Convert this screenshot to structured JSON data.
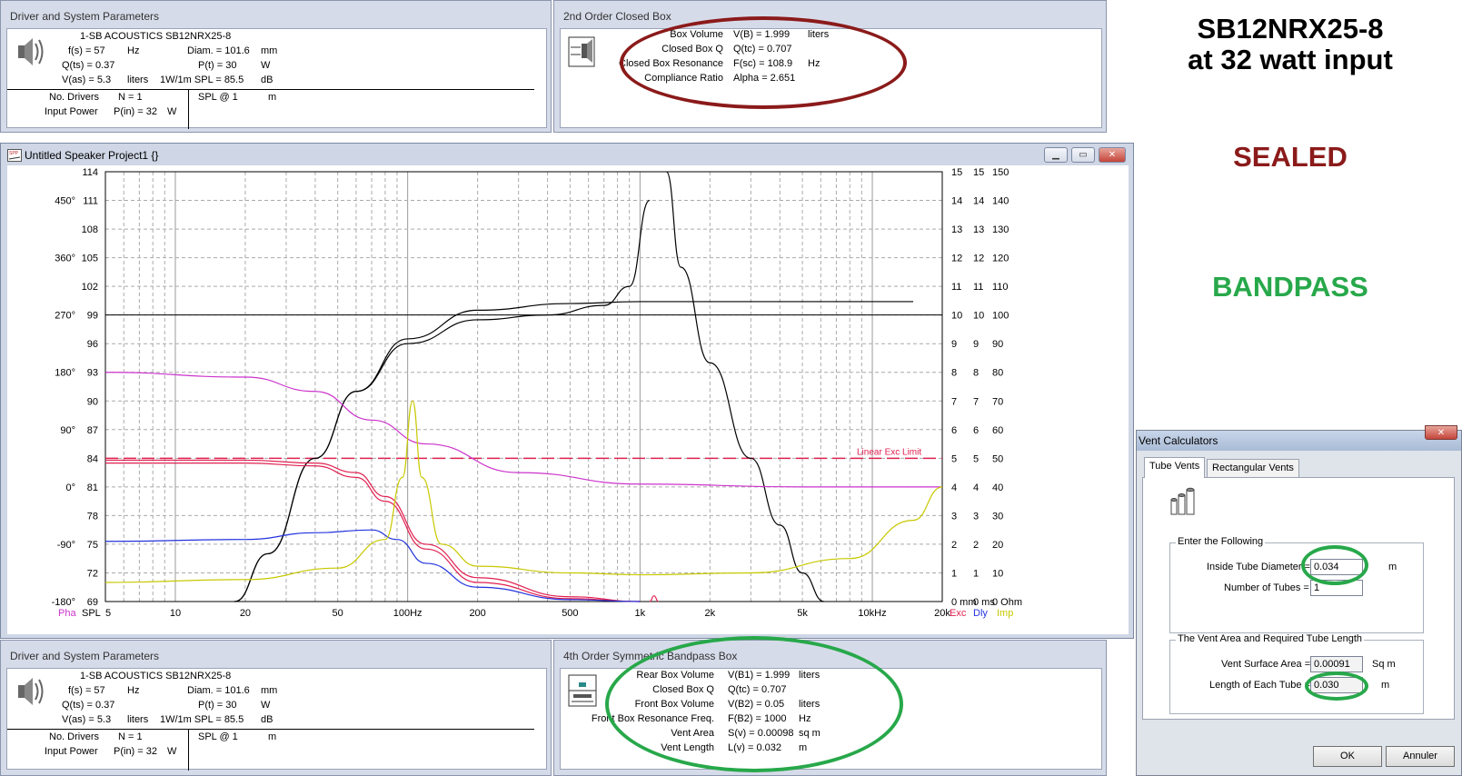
{
  "driver_panel": {
    "title": "Driver and System Parameters",
    "name": "1-SB ACOUSTICS SB12NRX25-8",
    "fs_label": "f(s) = 57",
    "fs_unit": "Hz",
    "qs_label": "Q(ts) = 0.37",
    "vas_label": "V(as) = 5.3",
    "vas_unit": "liters",
    "diam_label": "Diam. = 101.6",
    "diam_unit": "mm",
    "pt_label": "P(t) = 30",
    "pt_unit": "W",
    "spl_label": "1W/1m SPL = 85.5",
    "spl_unit": "dB",
    "ndrivers_label": "No. Drivers",
    "ndrivers_value": "N = 1",
    "power_label": "Input Power",
    "power_value": "P(in) = 32",
    "power_unit": "W",
    "splat_label": "SPL @ 1",
    "splat_unit": "m"
  },
  "closed_box": {
    "title": "2nd Order Closed Box",
    "rows": [
      {
        "label": "Box Volume",
        "value": "V(B) = 1.999",
        "unit": "liters"
      },
      {
        "label": "Closed Box Q",
        "value": "Q(tc) = 0.707",
        "unit": ""
      },
      {
        "label": "Closed Box Resonance",
        "value": "F(sc) = 108.9",
        "unit": "Hz"
      },
      {
        "label": "Compliance Ratio",
        "value": "Alpha = 2.651",
        "unit": ""
      }
    ]
  },
  "bandpass_box": {
    "title": "4th Order Symmetric Bandpass Box",
    "rows": [
      {
        "label": "Rear Box Volume",
        "value": "V(B1) = 1.999",
        "unit": "liters"
      },
      {
        "label": "Closed Box Q",
        "value": "Q(tc) = 0.707",
        "unit": ""
      },
      {
        "label": "Front Box Volume",
        "value": "V(B2) = 0.05",
        "unit": "liters"
      },
      {
        "label": "Front Box Resonance Freq.",
        "value": "F(B2) = 1000",
        "unit": "Hz"
      },
      {
        "label": "Vent Area",
        "value": "S(v) = 0.00098",
        "unit": "sq m"
      },
      {
        "label": "Vent Length",
        "value": "L(v) = 0.032",
        "unit": "m"
      }
    ]
  },
  "project_window": {
    "title": "Untitled Speaker Project1 {}",
    "minimize": "▁",
    "maximize": "▭",
    "close": "✕"
  },
  "annotations": {
    "heading_line1": "SB12NRX25-8",
    "heading_line2": "at 32 watt input",
    "sealed": "SEALED",
    "bandpass": "BANDPASS",
    "sealed_color": "#8b1a1a",
    "bandpass_color": "#27a84a"
  },
  "vent_dialog": {
    "title": "Vent Calculators",
    "tab_tube": "Tube Vents",
    "tab_rect": "Rectangular Vents",
    "group1_label": "Enter the Following",
    "diameter_label": "Inside Tube Diameter =",
    "diameter_value": "0.034",
    "diameter_unit": "m",
    "ntubes_label": "Number of Tubes =",
    "ntubes_value": "1",
    "group2_label": "The Vent Area and Required Tube Length",
    "area_label": "Vent Surface Area =",
    "area_value": "0.00091",
    "area_unit": "Sq m",
    "length_label": "Length of Each Tube =",
    "length_value": "0.030",
    "length_unit": "m",
    "ok": "OK",
    "cancel": "Annuler"
  },
  "chart_data": {
    "type": "line",
    "xscale": "log",
    "xlim": [
      5,
      20000
    ],
    "x_ticks": [
      "5",
      "10",
      "20",
      "50",
      "100Hz",
      "200",
      "500",
      "1k",
      "2k",
      "5k",
      "10kHz",
      "20k"
    ],
    "x_tick_values": [
      5,
      10,
      20,
      50,
      100,
      200,
      500,
      1000,
      2000,
      5000,
      10000,
      20000
    ],
    "spl_axis": {
      "label": "SPL",
      "ylim": [
        69,
        114
      ],
      "ticks": [
        "114",
        "111",
        "108",
        "105",
        "102",
        "99",
        "96",
        "93",
        "90",
        "87",
        "84",
        "81",
        "78",
        "75",
        "72",
        "69"
      ]
    },
    "phase_axis": {
      "label": "Pha",
      "ticks": [
        "450°",
        "360°",
        "270°",
        "180°",
        "90°",
        "0°",
        "-90°",
        "-180°"
      ],
      "tick_values": [
        450,
        360,
        270,
        180,
        90,
        0,
        -90,
        -180
      ]
    },
    "right_axes": {
      "exc": {
        "label": "Exc",
        "unit": "mm",
        "ticks": [
          "15",
          "14",
          "13",
          "12",
          "11",
          "10",
          "9",
          "8",
          "7",
          "6",
          "5",
          "4",
          "3",
          "2",
          "1",
          "0 mm"
        ]
      },
      "dly": {
        "label": "Dly",
        "unit": "ms",
        "ticks": [
          "15",
          "14",
          "13",
          "12",
          "11",
          "10",
          "9",
          "8",
          "7",
          "6",
          "5",
          "4",
          "3",
          "2",
          "1",
          "0 ms"
        ]
      },
      "imp": {
        "label": "Imp",
        "unit": "Ohm",
        "ticks": [
          "150",
          "140",
          "130",
          "120",
          "110",
          "100",
          "90",
          "80",
          "70",
          "60",
          "50",
          "40",
          "30",
          "20",
          "10",
          "0 Ohm"
        ]
      }
    },
    "limit_label": "Linear Exc Limit",
    "limit_value": 84,
    "reference_line": 99,
    "series": [
      {
        "color": "#000000",
        "points": [
          [
            18,
            69
          ],
          [
            25,
            74
          ],
          [
            40,
            84
          ],
          [
            60,
            91
          ],
          [
            100,
            96.5
          ],
          [
            200,
            99.5
          ],
          [
            500,
            100.2
          ],
          [
            1000,
            100.4
          ],
          [
            2000,
            100.4
          ],
          [
            5000,
            100.4
          ],
          [
            15000,
            100.4
          ]
        ]
      },
      {
        "color": "#000000",
        "points": [
          [
            18,
            69
          ],
          [
            25,
            74
          ],
          [
            40,
            84
          ],
          [
            60,
            91
          ],
          [
            100,
            96
          ],
          [
            200,
            98.5
          ],
          [
            400,
            99
          ],
          [
            700,
            100
          ],
          [
            900,
            102
          ],
          [
            1100,
            111
          ]
        ]
      },
      {
        "color": "#000000",
        "points": [
          [
            1300,
            114
          ],
          [
            1500,
            104
          ],
          [
            2000,
            94
          ],
          [
            3000,
            84
          ],
          [
            4000,
            77
          ],
          [
            5000,
            72
          ],
          [
            6200,
            69
          ]
        ]
      },
      {
        "color": "#cc33cc",
        "points": [
          [
            5,
            93
          ],
          [
            20,
            92.5
          ],
          [
            40,
            91
          ],
          [
            70,
            88
          ],
          [
            120,
            85.5
          ],
          [
            300,
            82.5
          ],
          [
            1000,
            81.3
          ],
          [
            5000,
            81
          ],
          [
            20000,
            81
          ]
        ]
      },
      {
        "color": "#e02050",
        "points": [
          [
            5,
            83.8
          ],
          [
            20,
            83.8
          ],
          [
            40,
            83.5
          ],
          [
            60,
            82.5
          ],
          [
            80,
            80
          ],
          [
            120,
            75
          ],
          [
            200,
            71.5
          ],
          [
            500,
            69.5
          ],
          [
            1000,
            69
          ]
        ]
      },
      {
        "color": "#e02050",
        "points": [
          [
            5,
            83.5
          ],
          [
            20,
            83.5
          ],
          [
            40,
            83.2
          ],
          [
            60,
            82
          ],
          [
            80,
            79.5
          ],
          [
            120,
            74.5
          ],
          [
            200,
            71
          ],
          [
            500,
            69.3
          ],
          [
            1000,
            69
          ]
        ]
      },
      {
        "color": "#e02050",
        "points": [
          [
            1100,
            69
          ],
          [
            1150,
            69.6
          ],
          [
            1200,
            69
          ]
        ]
      },
      {
        "color": "#2233dd",
        "points": [
          [
            5,
            75.3
          ],
          [
            20,
            75.5
          ],
          [
            40,
            76.2
          ],
          [
            70,
            76.5
          ],
          [
            90,
            75.5
          ],
          [
            120,
            73
          ],
          [
            200,
            70.5
          ],
          [
            500,
            69.2
          ],
          [
            1000,
            69
          ]
        ]
      },
      {
        "color": "#c8c800",
        "points": [
          [
            5,
            71
          ],
          [
            20,
            71.3
          ],
          [
            50,
            72.5
          ],
          [
            80,
            75.5
          ],
          [
            95,
            82
          ],
          [
            105,
            90
          ],
          [
            115,
            82
          ],
          [
            140,
            75
          ],
          [
            200,
            72.7
          ],
          [
            500,
            72
          ],
          [
            1000,
            71.8
          ],
          [
            3000,
            72
          ],
          [
            8000,
            73.5
          ],
          [
            15000,
            77.5
          ],
          [
            20000,
            81
          ]
        ]
      }
    ]
  }
}
